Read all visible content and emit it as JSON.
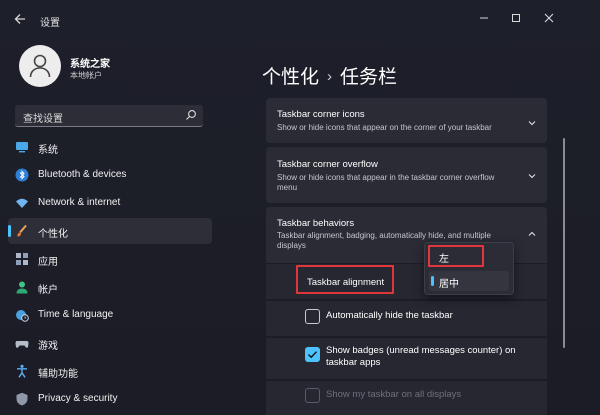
{
  "window": {
    "title": "设置",
    "back_icon": "back-arrow-icon",
    "controls": [
      "minimize-icon",
      "maximize-icon",
      "close-icon"
    ]
  },
  "profile": {
    "name": "系统之家",
    "account_type": "本地帐户"
  },
  "search": {
    "placeholder": "查找设置"
  },
  "sidebar": {
    "items": [
      {
        "label": "系统",
        "icon": "monitor-icon",
        "active": false
      },
      {
        "label": "Bluetooth & devices",
        "icon": "bluetooth-icon",
        "active": false
      },
      {
        "label": "Network & internet",
        "icon": "wifi-icon",
        "active": false
      },
      {
        "label": "个性化",
        "icon": "brush-icon",
        "active": true
      },
      {
        "label": "应用",
        "icon": "apps-icon",
        "active": false
      },
      {
        "label": "帐户",
        "icon": "person-icon",
        "active": false
      },
      {
        "label": "Time & language",
        "icon": "globe-clock-icon",
        "active": false
      },
      {
        "label": "游戏",
        "icon": "gamepad-icon",
        "active": false
      },
      {
        "label": "辅助功能",
        "icon": "accessibility-icon",
        "active": false
      },
      {
        "label": "Privacy & security",
        "icon": "shield-icon",
        "active": false
      }
    ]
  },
  "header": {
    "parent": "个性化",
    "separator": "›",
    "current": "任务栏"
  },
  "sections": [
    {
      "title": "Taskbar corner icons",
      "description": "Show or hide icons that appear on the corner of your taskbar",
      "expanded": false
    },
    {
      "title": "Taskbar corner overflow",
      "description": "Show or hide icons that appear in the taskbar corner overflow menu",
      "expanded": false
    },
    {
      "title": "Taskbar behaviors",
      "description": "Taskbar alignment, badging, automatically hide, and multiple displays",
      "expanded": true
    }
  ],
  "behaviors": {
    "alignment_label": "Taskbar alignment",
    "alignment_options": [
      "左",
      "居中"
    ],
    "alignment_selected": "居中",
    "checkboxes": [
      {
        "label": "Automatically hide the taskbar",
        "checked": false,
        "enabled": true
      },
      {
        "label": "Show badges (unread messages counter) on taskbar apps",
        "checked": true,
        "enabled": true
      },
      {
        "label": "Show my taskbar on all displays",
        "checked": false,
        "enabled": false
      }
    ]
  },
  "colors": {
    "accent": "#4cc2ff",
    "highlight_box": "#e0363c",
    "background": "#1f1f28",
    "card": "#2a2b35"
  }
}
